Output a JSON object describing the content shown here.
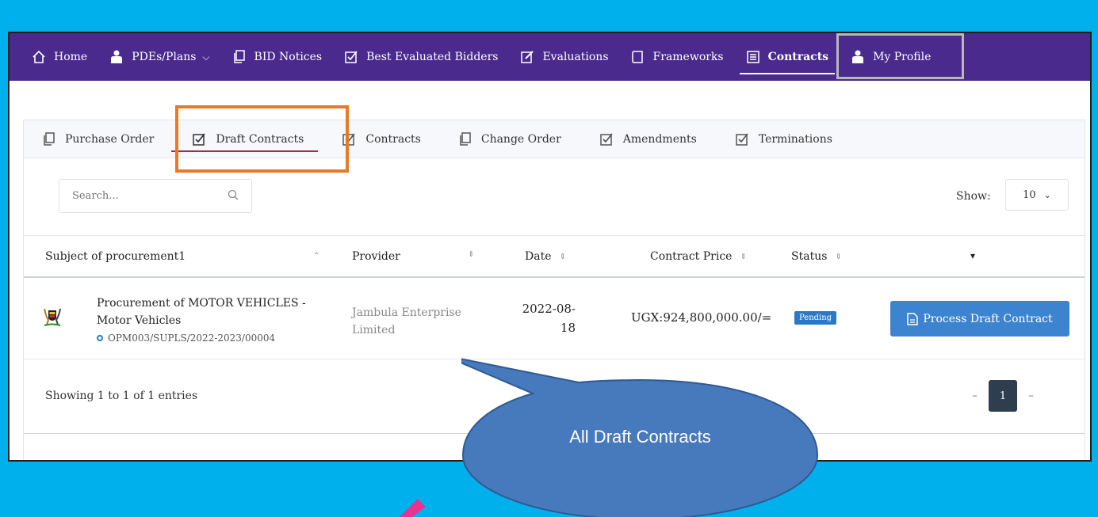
{
  "nav": {
    "items": [
      {
        "label": "Home",
        "icon": "home-icon"
      },
      {
        "label": "PDEs/Plans",
        "icon": "user-icon",
        "dropdown": true
      },
      {
        "label": "BID Notices",
        "icon": "copy-icon"
      },
      {
        "label": "Best Evaluated Bidders",
        "icon": "check-square-icon"
      },
      {
        "label": "Evaluations",
        "icon": "edit-icon"
      },
      {
        "label": "Frameworks",
        "icon": "book-icon"
      },
      {
        "label": "Contracts",
        "icon": "list-icon",
        "active": true
      },
      {
        "label": "My Profile",
        "icon": "user-icon"
      }
    ],
    "chevron": "⌵"
  },
  "tabs": [
    {
      "label": "Purchase Order",
      "icon": "copy-icon"
    },
    {
      "label": "Draft Contracts",
      "icon": "check-square-icon",
      "active": true
    },
    {
      "label": "Contracts",
      "icon": "check-square-icon"
    },
    {
      "label": "Change Order",
      "icon": "copy-icon"
    },
    {
      "label": "Amendments",
      "icon": "check-square-icon"
    },
    {
      "label": "Terminations",
      "icon": "check-square-icon"
    }
  ],
  "search": {
    "placeholder": "Search..."
  },
  "show": {
    "label": "Show:",
    "value": "10"
  },
  "table": {
    "headers": {
      "subject": "Subject of procurement1",
      "provider": "Provider",
      "date": "Date",
      "price": "Contract Price",
      "status": "Status"
    },
    "rows": [
      {
        "subject_title": "Procurement of MOTOR VEHICLES - Motor Vehicles",
        "reference": "OPM003/SUPLS/2022-2023/00004",
        "provider": "Jambula Enterprise Limited",
        "date": "2022-08-18",
        "price": "UGX:924,800,000.00/=",
        "status": "Pending",
        "action": "Process Draft Contract"
      }
    ]
  },
  "footer": {
    "showing": "Showing 1 to 1 of 1 entries",
    "prev": "–",
    "page": "1",
    "next": "–"
  },
  "callout": {
    "text": "All Draft Contracts"
  },
  "colors": {
    "background": "#00b0ec",
    "nav": "#4b2a8e",
    "tab_highlight": "#e67a27",
    "tab_underline": "#b4234b",
    "primary": "#3c84cf",
    "callout": "#4779bd",
    "arrow": "#e8338f"
  }
}
